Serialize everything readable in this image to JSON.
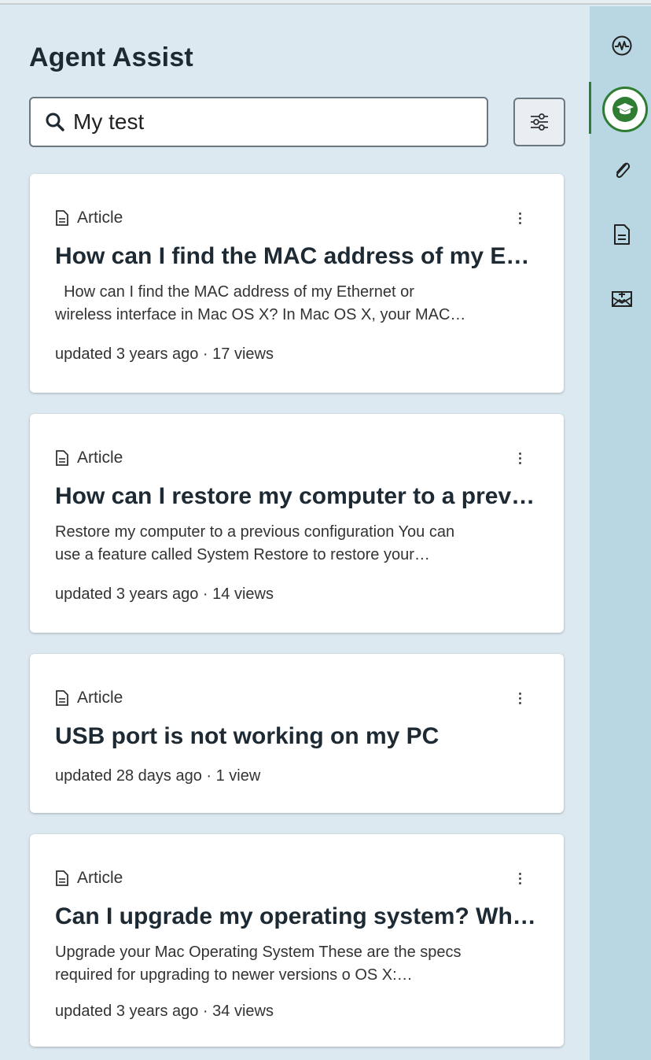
{
  "header": {
    "title": "Agent Assist"
  },
  "search": {
    "value": "My test",
    "placeholder": ""
  },
  "colors": {
    "accent": "#2e7d32",
    "panel_bg": "#dde9f1",
    "rail_bg": "#b9d7e2"
  },
  "icons": {
    "search": "search-icon",
    "filter": "filter-sliders-icon",
    "article": "document-icon",
    "more": "kebab-menu-icon",
    "rail": [
      "activity-icon",
      "graduation-cap-icon",
      "paperclip-icon",
      "document-icon",
      "mail-add-icon"
    ]
  },
  "results": [
    {
      "type": "Article",
      "title": "How can I find the MAC address of my Et…",
      "desc_lines": [
        "  How can I find the MAC address of my Ethernet or",
        "wireless interface in Mac OS X? In Mac OS X, your MAC…"
      ],
      "meta": "updated 3 years ago · 17 views"
    },
    {
      "type": "Article",
      "title": "How can I restore my computer to a previ…",
      "desc_lines": [
        "Restore my computer to a previous configuration You can",
        "use a feature called System Restore to restore your…"
      ],
      "meta": "updated 3 years ago · 14 views"
    },
    {
      "type": "Article",
      "title": "USB port is not working on my PC",
      "desc_lines": [],
      "meta": "updated 28 days ago · 1 view"
    },
    {
      "type": "Article",
      "title": "Can I upgrade my operating system? Wha…",
      "desc_lines": [
        "Upgrade your Mac Operating System These are the specs",
        "required for upgrading to newer versions o OS X:…"
      ],
      "meta": "updated 3 years ago · 34 views"
    }
  ]
}
